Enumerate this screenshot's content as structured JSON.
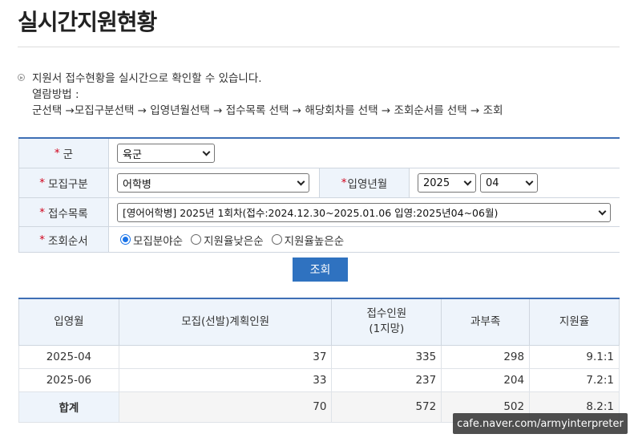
{
  "page_title": "실시간지원현황",
  "info": {
    "line1": "지원서 접수현황을 실시간으로 확인할 수 있습니다.",
    "line2": "열람방법 :",
    "line3": "군선택 →모집구분선택 → 입영년월선택 → 접수목록 선택 → 해당회차를 선택 → 조회순서를 선택 → 조회"
  },
  "form": {
    "required_mark": "*",
    "branch": {
      "label": "군",
      "value": "육군"
    },
    "recruit_type": {
      "label": "모집구분",
      "value": "어학병"
    },
    "enlist_month": {
      "label": "입영년월",
      "year": "2025",
      "month": "04"
    },
    "application_list": {
      "label": "접수목록",
      "value": "[영어어학병] 2025년 1회차(접수:2024.12.30~2025.01.06 입영:2025년04~06월)"
    },
    "sort_order": {
      "label": "조회순서",
      "options": [
        "모집분야순",
        "지원율낮은순",
        "지원율높은순"
      ],
      "selected_index": 0
    }
  },
  "search_button": "조회",
  "table": {
    "headers": [
      "입영월",
      "모집(선발)계획인원",
      "접수인원",
      "(1지망)",
      "과부족",
      "지원율"
    ],
    "rows": [
      [
        "2025-04",
        "37",
        "335",
        "298",
        "9.1:1"
      ],
      [
        "2025-06",
        "33",
        "237",
        "204",
        "7.2:1"
      ]
    ],
    "total": [
      "합계",
      "70",
      "572",
      "502",
      "8.2:1"
    ]
  },
  "watermark": "cafe.naver.com/armyinterpreter",
  "colors": {
    "accent": "#2f72c0",
    "header_bg": "#eef4fb",
    "required": "#d0021b"
  }
}
